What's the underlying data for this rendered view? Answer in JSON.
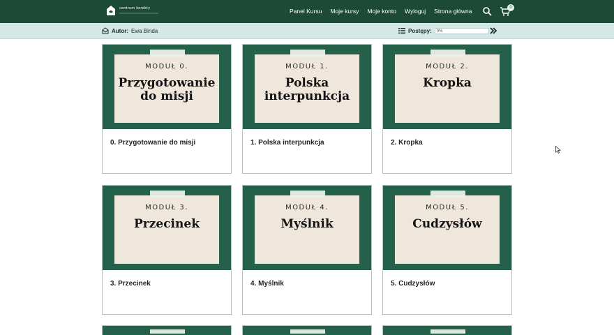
{
  "header": {
    "logo_text": "centrum korekty",
    "nav": [
      "Panel Kursu",
      "Moje kursy",
      "Moje konto",
      "Wyloguj",
      "Strona główna"
    ],
    "cart_count": "0",
    "icons": {
      "logo": "house-logo-icon",
      "search": "search-icon",
      "cart": "cart-icon"
    }
  },
  "course_bar": {
    "author_label": "Autor:",
    "author_name": "Ewa Binda",
    "progress_label": "Postępy:",
    "progress_value": "0%",
    "progress_fraction": 0
  },
  "modules": [
    {
      "label": "MODUŁ 0.",
      "cover_title": "Przygotowanie do misji",
      "caption": "0. Przygotowanie do misji"
    },
    {
      "label": "MODUŁ 1.",
      "cover_title": "Polska interpunkcja",
      "caption": "1. Polska interpunkcja"
    },
    {
      "label": "MODUŁ 2.",
      "cover_title": "Kropka",
      "caption": "2. Kropka"
    },
    {
      "label": "MODUŁ 3.",
      "cover_title": "Przecinek",
      "caption": "3. Przecinek"
    },
    {
      "label": "MODUŁ 4.",
      "cover_title": "Myślnik",
      "caption": "4. Myślnik"
    },
    {
      "label": "MODUŁ 5.",
      "cover_title": "Cudzysłów",
      "caption": "5. Cudzysłów"
    }
  ],
  "colors": {
    "nav_bg": "#1d4a37",
    "subbar_bg": "#d4e8e6",
    "cover_bg": "#25604a",
    "paper": "#efe7db"
  }
}
